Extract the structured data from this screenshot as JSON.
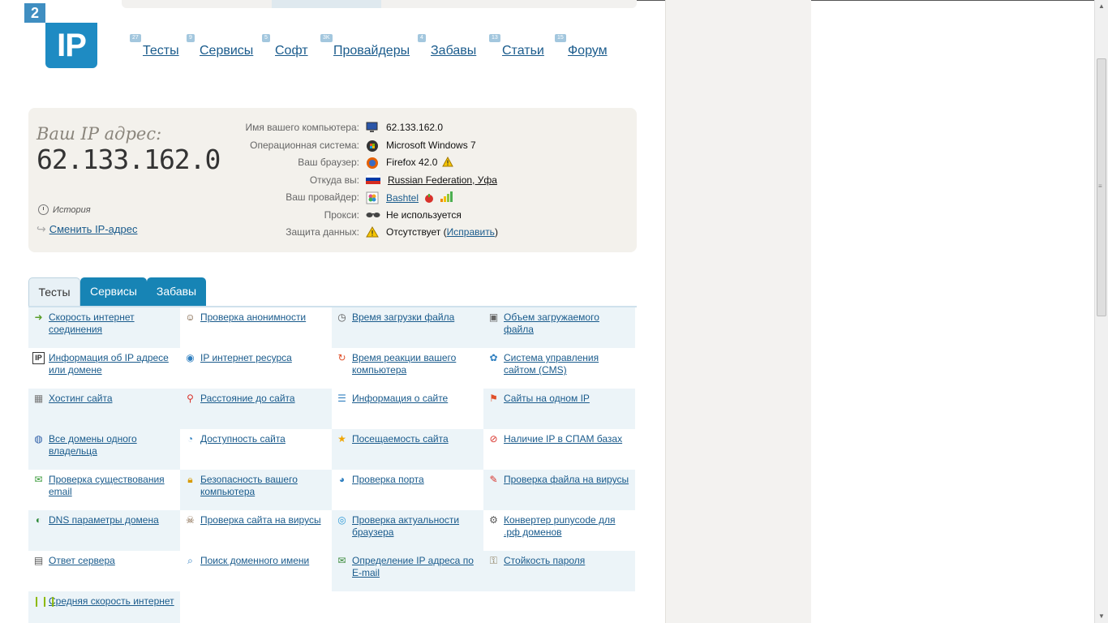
{
  "logo": {
    "number": "2",
    "text": "IP"
  },
  "nav": [
    {
      "badge": "27",
      "label": "Тесты"
    },
    {
      "badge": "9",
      "label": "Сервисы"
    },
    {
      "badge": "5",
      "label": "Софт"
    },
    {
      "badge": "3K",
      "label": "Провайдеры"
    },
    {
      "badge": "4",
      "label": "Забавы"
    },
    {
      "badge": "13",
      "label": "Статьи"
    },
    {
      "badge": "15",
      "label": "Форум"
    }
  ],
  "info": {
    "title": "Ваш IP адрес:",
    "ip": "62.133.162.0",
    "history": "История",
    "change_ip": "Сменить IP-адрес",
    "rows": [
      {
        "label": "Имя вашего компьютера:",
        "icon": "computer-icon",
        "value": "62.133.162.0"
      },
      {
        "label": "Операционная система:",
        "icon": "windows-icon",
        "value": "Microsoft Windows 7"
      },
      {
        "label": "Ваш браузер:",
        "icon": "firefox-icon",
        "value": "Firefox 42.0"
      },
      {
        "label": "Откуда вы:",
        "icon": "flag-ru-icon",
        "value": "Russian Federation, Уфа"
      },
      {
        "label": "Ваш провайдер:",
        "icon": "provider-icon",
        "value": "Bashtel"
      },
      {
        "label": "Прокси:",
        "icon": "glasses-icon",
        "value": "Не используется"
      },
      {
        "label": "Защита данных:",
        "icon": "warning-icon",
        "value_prefix": "Отсутствует (",
        "value_link": "Исправить",
        "value_suffix": ")"
      }
    ]
  },
  "tabs": [
    "Тесты",
    "Сервисы",
    "Забавы"
  ],
  "tests": [
    {
      "icon": "speed-arrow-icon",
      "label": "Скорость интернет соединения"
    },
    {
      "icon": "anonymity-icon",
      "label": "Проверка анонимности"
    },
    {
      "icon": "clock-icon",
      "label": "Время загрузки файла"
    },
    {
      "icon": "volume-icon",
      "label": "Объем загружаемого файла"
    },
    {
      "icon": "ip-icon",
      "label": "Информация об IP адресе или домене"
    },
    {
      "icon": "ip-resource-icon",
      "label": "IP интернет ресурса"
    },
    {
      "icon": "reaction-icon",
      "label": "Время реакции вашего компьютера"
    },
    {
      "icon": "cms-icon",
      "label": "Система управления сайтом (CMS)"
    },
    {
      "icon": "hosting-icon",
      "label": "Хостинг сайта"
    },
    {
      "icon": "map-pin-icon",
      "label": "Расстояние до сайта"
    },
    {
      "icon": "document-icon",
      "label": "Информация о сайте"
    },
    {
      "icon": "sites-icon",
      "label": "Сайты на одном IP"
    },
    {
      "icon": "domains-icon",
      "label": "Все домены одного владельца"
    },
    {
      "icon": "availability-icon",
      "label": "Доступность сайта"
    },
    {
      "icon": "star-icon",
      "label": "Посещаемость сайта"
    },
    {
      "icon": "spam-icon",
      "label": "Наличие IP в СПАМ базах"
    },
    {
      "icon": "email-check-icon",
      "label": "Проверка существования email"
    },
    {
      "icon": "lock-icon",
      "label": "Безопасность вашего компьютера"
    },
    {
      "icon": "globe-icon",
      "label": "Проверка порта"
    },
    {
      "icon": "virus-file-icon",
      "label": "Проверка файла на вирусы"
    },
    {
      "icon": "dns-icon",
      "label": "DNS параметры домена"
    },
    {
      "icon": "site-virus-icon",
      "label": "Проверка сайта на вирусы"
    },
    {
      "icon": "browser-icon",
      "label": "Проверка актуальности браузера"
    },
    {
      "icon": "converter-icon",
      "label": "Конвертер punycode для .рф доменов"
    },
    {
      "icon": "server-icon",
      "label": "Ответ сервера"
    },
    {
      "icon": "search-domain-icon",
      "label": "Поиск доменного имени"
    },
    {
      "icon": "email-ip-icon",
      "label": "Определение IP адреса по E-mail"
    },
    {
      "icon": "password-icon",
      "label": "Стойкость пароля"
    },
    {
      "icon": "bars-icon",
      "label": "Средняя скорость интернет"
    }
  ],
  "colors": {
    "accent": "#1784b5",
    "link": "#1a5b8c",
    "panel": "#f3f1ec"
  }
}
